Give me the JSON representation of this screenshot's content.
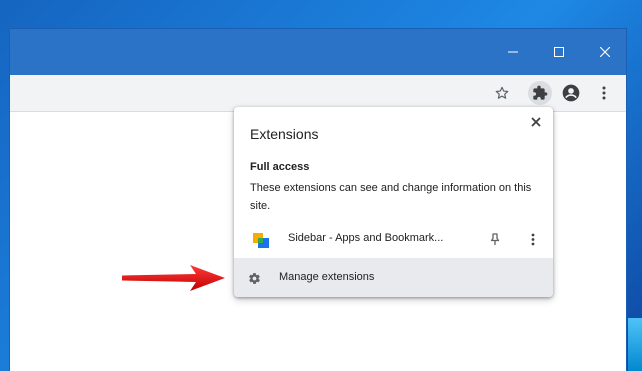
{
  "window": {
    "controls": {
      "minimize_icon": "minimize-icon",
      "maximize_icon": "maximize-icon",
      "close_icon": "close-icon"
    }
  },
  "toolbar": {
    "icons": [
      "star-icon",
      "puzzle-icon",
      "account-icon",
      "kebab-menu-icon"
    ]
  },
  "extensions_popup": {
    "title": "Extensions",
    "section_title": "Full access",
    "section_description": "These extensions can see and change information on this site.",
    "extensions": [
      {
        "name": "Sidebar - Apps and Bookmark...",
        "icon": "sidebar-extension-icon"
      }
    ],
    "manage_label": "Manage extensions"
  },
  "annotation": {
    "arrow_color": "#e8161b"
  },
  "colors": {
    "titlebar": "#2b73c7",
    "toolbar": "#f1f3f4",
    "manage_row": "#e8eaed"
  }
}
